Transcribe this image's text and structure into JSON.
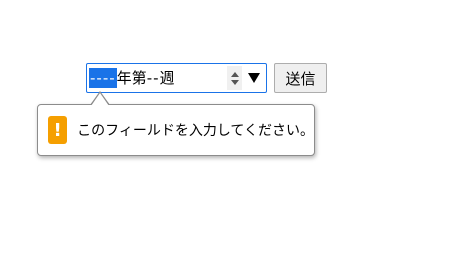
{
  "form": {
    "week_input": {
      "year_placeholder": "----",
      "year_suffix": "年",
      "week_prefix": "第",
      "week_placeholder": "--",
      "week_suffix": "週"
    },
    "submit_label": "送信"
  },
  "validation": {
    "message": "このフィールドを入力してください。",
    "icon_glyph": "!",
    "icon": "warning-icon"
  },
  "colors": {
    "focus_border": "#1a73e8",
    "selected_segment": "#1a73e8",
    "warning": "#f59f00"
  }
}
